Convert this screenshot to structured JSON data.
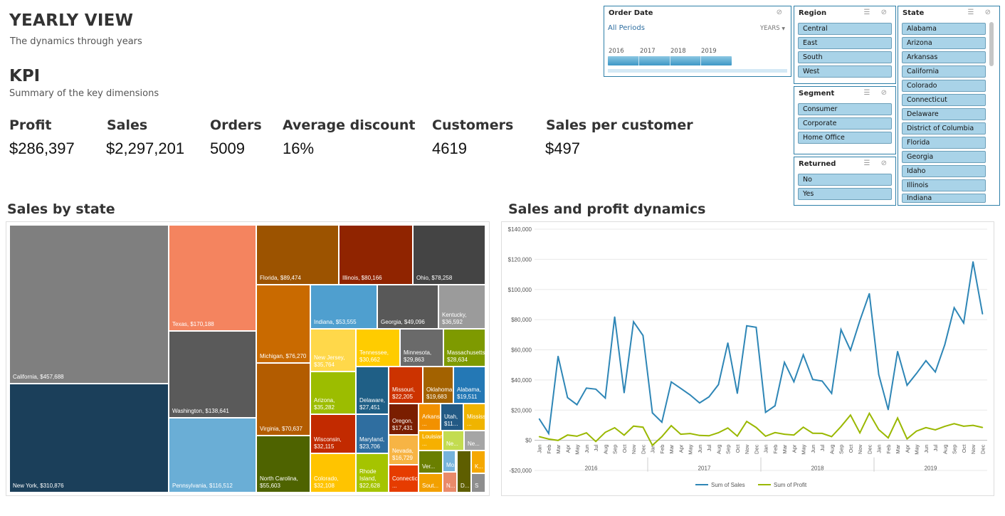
{
  "header": {
    "title": "YEARLY VIEW",
    "subtitle": "The dynamics through years",
    "kpi_title": "KPI",
    "kpi_subtitle": "Summary of the key dimensions"
  },
  "kpis": [
    {
      "label": "Profit",
      "value": "$286,397"
    },
    {
      "label": "Sales",
      "value": "$2,297,201"
    },
    {
      "label": "Orders",
      "value": "5009"
    },
    {
      "label": "Average discount",
      "value": "16%"
    },
    {
      "label": "Customers",
      "value": "4619"
    },
    {
      "label": "Sales per customer",
      "value": "$497"
    }
  ],
  "slicers": {
    "order_date": {
      "title": "Order Date",
      "period": "All Periods",
      "unit": "YEARS",
      "years": [
        "2016",
        "2017",
        "2018",
        "2019"
      ]
    },
    "region": {
      "title": "Region",
      "items": [
        "Central",
        "East",
        "South",
        "West"
      ]
    },
    "segment": {
      "title": "Segment",
      "items": [
        "Consumer",
        "Corporate",
        "Home Office"
      ]
    },
    "returned": {
      "title": "Returned",
      "items": [
        "No",
        "Yes"
      ]
    },
    "state": {
      "title": "State",
      "items": [
        "Alabama",
        "Arizona",
        "Arkansas",
        "California",
        "Colorado",
        "Connecticut",
        "Delaware",
        "District of Columbia",
        "Florida",
        "Georgia",
        "Idaho",
        "Illinois",
        "Indiana"
      ]
    }
  },
  "sections": {
    "treemap_title": "Sales by state",
    "line_title": "Sales and profit dynamics"
  },
  "treemap": [
    {
      "label": "California, $457,688",
      "color": "#7f7f7f"
    },
    {
      "label": "New York, $310,876",
      "color": "#1b3f5a"
    },
    {
      "label": "Texas, $170,188",
      "color": "#f4845f"
    },
    {
      "label": "Washington, $138,641",
      "color": "#5a5a5a"
    },
    {
      "label": "Pennsylvania, $116,512",
      "color": "#6aaed6"
    },
    {
      "label": "Florida, $89,474",
      "color": "#9c5300"
    },
    {
      "label": "Illinois, $80,166",
      "color": "#902400"
    },
    {
      "label": "Ohio, $78,258",
      "color": "#444444"
    },
    {
      "label": "Michigan, $76,270",
      "color": "#c96a00"
    },
    {
      "label": "Virginia, $70,637",
      "color": "#b35c00"
    },
    {
      "label": "North Carolina, $55,603",
      "color": "#4e6300"
    },
    {
      "label": "Indiana, $53,555",
      "color": "#4f9fcf"
    },
    {
      "label": "Georgia, $49,096",
      "color": "#585858"
    },
    {
      "label": "Kentucky, $36,592",
      "color": "#9b9b9b"
    },
    {
      "label": "New Jersey, $35,764",
      "color": "#ffd84a"
    },
    {
      "label": "Tennessee, $30,662",
      "color": "#ffcc00"
    },
    {
      "label": "Minnesota, $29,863",
      "color": "#6a6a6a"
    },
    {
      "label": "Massachusetts, $28,634",
      "color": "#7e9a00"
    },
    {
      "label": "Arizona, $35,282",
      "color": "#9cbd00"
    },
    {
      "label": "Delaware, $27,451",
      "color": "#1f5f86"
    },
    {
      "label": "Missouri, $22,205",
      "color": "#cc3300"
    },
    {
      "label": "Oklahoma, $19,683",
      "color": "#a36200"
    },
    {
      "label": "Alabama, $19,511",
      "color": "#2478b5"
    },
    {
      "label": "Wisconsin, $32,115",
      "color": "#c22a00"
    },
    {
      "label": "Oregon, $17,431",
      "color": "#7a1e00"
    },
    {
      "label": "Arkansas, ...",
      "color": "#f29100"
    },
    {
      "label": "Utah, $11...",
      "color": "#235a85"
    },
    {
      "label": "Mississippi, ...",
      "color": "#f0b400"
    },
    {
      "label": "Maryland, $23,706",
      "color": "#2f6ea0"
    },
    {
      "label": "Louisiana, ...",
      "color": "#f6b000"
    },
    {
      "label": "Ne...",
      "color": "#c3dc50"
    },
    {
      "label": "Ne...",
      "color": "#a5a5a5"
    },
    {
      "label": "Colorado, $32,108",
      "color": "#ffc400"
    },
    {
      "label": "Nevada, $16,729",
      "color": "#f7b444"
    },
    {
      "label": "Rhode Island, $22,628",
      "color": "#a5c400"
    },
    {
      "label": "Ver...",
      "color": "#6a7f00"
    },
    {
      "label": "Mo...",
      "color": "#76b3dd"
    },
    {
      "label": "Connecticut, ...",
      "color": "#e63c00"
    },
    {
      "label": "Sout...",
      "color": "#f2a000"
    },
    {
      "label": "N...",
      "color": "#e98a6a"
    },
    {
      "label": "D...",
      "color": "#5e5e00"
    },
    {
      "label": "K...",
      "color": "#f5a800"
    },
    {
      "label": "S",
      "color": "#8e8e8e"
    }
  ],
  "chart_data": {
    "type": "line",
    "title": "Sales and profit dynamics",
    "years": [
      "2016",
      "2017",
      "2018",
      "2019"
    ],
    "months": [
      "Jan",
      "Feb",
      "Mar",
      "Apr",
      "May",
      "Jun",
      "Jul",
      "Aug",
      "Sep",
      "Oct",
      "Nov",
      "Dec"
    ],
    "ylim": [
      -20000,
      140000
    ],
    "yticks": [
      "$140,000",
      "$120,000",
      "$100,000",
      "$80,000",
      "$60,000",
      "$40,000",
      "$20,000",
      "$0",
      "-$20,000"
    ],
    "series": [
      {
        "name": "Sum of Sales",
        "color": "#2e86b6",
        "values": [
          14200,
          4500,
          55700,
          28300,
          23600,
          34600,
          33900,
          28000,
          81800,
          31500,
          78600,
          69500,
          18200,
          12000,
          38700,
          34400,
          30100,
          24800,
          28800,
          36900,
          64600,
          31100,
          75900,
          74900,
          18500,
          22900,
          51700,
          38800,
          56700,
          40300,
          39300,
          31100,
          73400,
          59700,
          79400,
          97300,
          43600,
          20300,
          58900,
          36500,
          44300,
          52800,
          45300,
          63400,
          87900,
          77800,
          118400,
          83800
        ]
      },
      {
        "name": "Sum of Profit",
        "color": "#9ab800",
        "values": [
          2400,
          800,
          -100,
          3500,
          2700,
          4900,
          -800,
          5300,
          8300,
          3400,
          9400,
          8700,
          -3300,
          2400,
          9700,
          4000,
          4500,
          3200,
          3000,
          5000,
          8200,
          2800,
          12500,
          8500,
          2700,
          5100,
          4000,
          3500,
          8700,
          4700,
          4600,
          2400,
          9100,
          16700,
          4900,
          17900,
          7100,
          1600,
          14800,
          900,
          6100,
          8400,
          6900,
          9200,
          11000,
          9300,
          9900,
          8500
        ]
      }
    ]
  }
}
